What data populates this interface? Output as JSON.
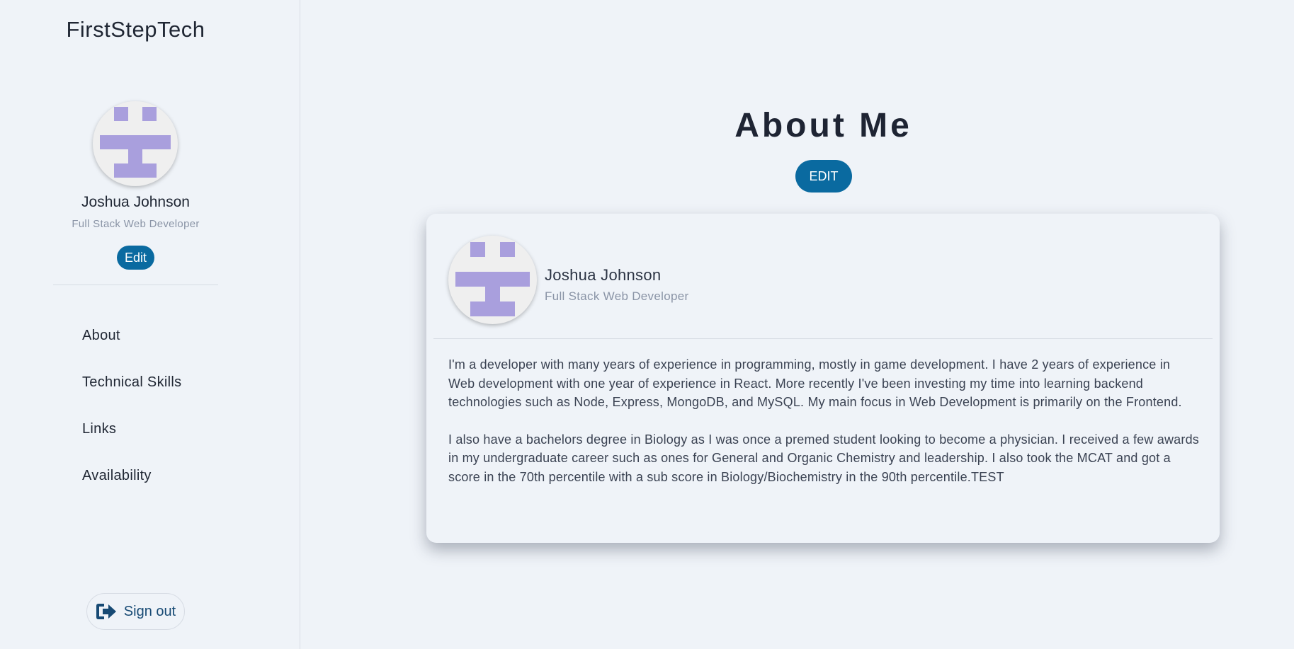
{
  "sidebar": {
    "brand": "FirstStepTech",
    "profile": {
      "name": "Joshua Johnson",
      "title": "Full Stack Web Developer",
      "edit_label": "Edit",
      "avatar_icon": "identicon-avatar"
    },
    "nav": [
      {
        "label": "About"
      },
      {
        "label": "Technical Skills"
      },
      {
        "label": "Links"
      },
      {
        "label": "Availability"
      }
    ],
    "signout": {
      "label": "Sign out",
      "icon": "sign-out-icon"
    }
  },
  "main": {
    "title": "About Me",
    "edit_label": "EDIT",
    "card": {
      "name": "Joshua Johnson",
      "title": "Full Stack Web Developer",
      "paragraphs": [
        "I'm a developer with many years of experience in programming, mostly in game development. I have 2 years of experience in Web development with one year of experience in React. More recently I've been investing my time into learning backend technologies such as Node, Express, MongoDB, and MySQL. My main focus in Web Development is primarily on the Frontend.",
        "I also have a bachelors degree in Biology as I was once a premed student looking to become a physician. I received a few awards in my undergraduate career such as ones for General and Organic Chemistry and leadership. I also took the MCAT and got a score in the 70th percentile with a sub score in Biology/Biochemistry in the 90th percentile.TEST"
      ]
    }
  },
  "colors": {
    "background": "#eff3f8",
    "accent": "#0a6aa0",
    "identicon": "#a99fdd",
    "signout_text": "#174a74"
  }
}
